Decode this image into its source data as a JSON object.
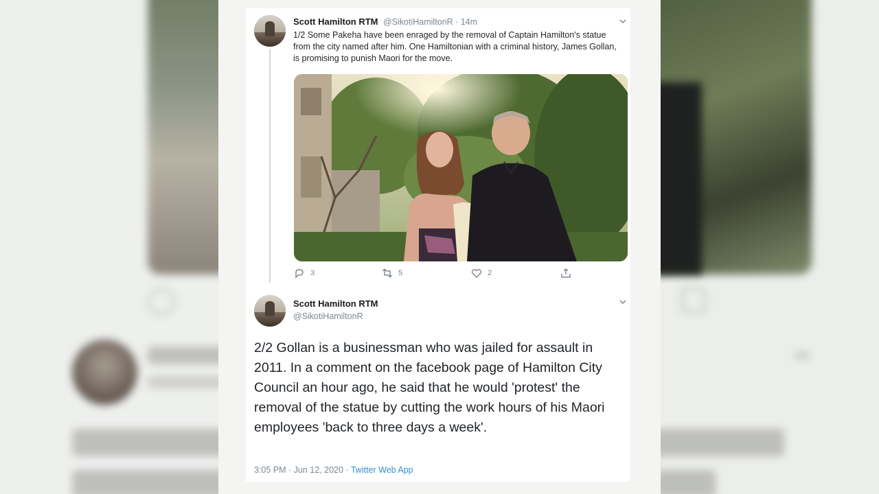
{
  "tweet1": {
    "author_name": "Scott Hamilton RTM",
    "handle": "@SikotiHamiltonR",
    "time": "14m",
    "text": "1/2 Some Pakeha have been enraged by the removal of Captain Hamilton's statue from the city named after him. One Hamiltonian with a criminal history, James Gollan, is promising to punish Maori for the move.",
    "replies": "3",
    "retweets": "5",
    "likes": "2"
  },
  "tweet2": {
    "author_name": "Scott Hamilton RTM",
    "handle": "@SikotiHamiltonR",
    "text": "2/2 Gollan is a businessman who was jailed for assault in 2011. In a comment on the facebook page of Hamilton City Council an hour ago, he said that he would 'protest' the removal of the statue by cutting the work hours of his Maori employees 'back to three days a week'.",
    "timestamp": "3:05 PM · Jun 12, 2020",
    "separator": " · ",
    "source": "Twitter Web App"
  },
  "colors": {
    "link": "#2f8fd4",
    "muted": "#7b8790",
    "text": "#1f2327"
  },
  "icons": [
    "reply-icon",
    "retweet-icon",
    "like-icon",
    "share-icon",
    "chevron-down-icon"
  ]
}
